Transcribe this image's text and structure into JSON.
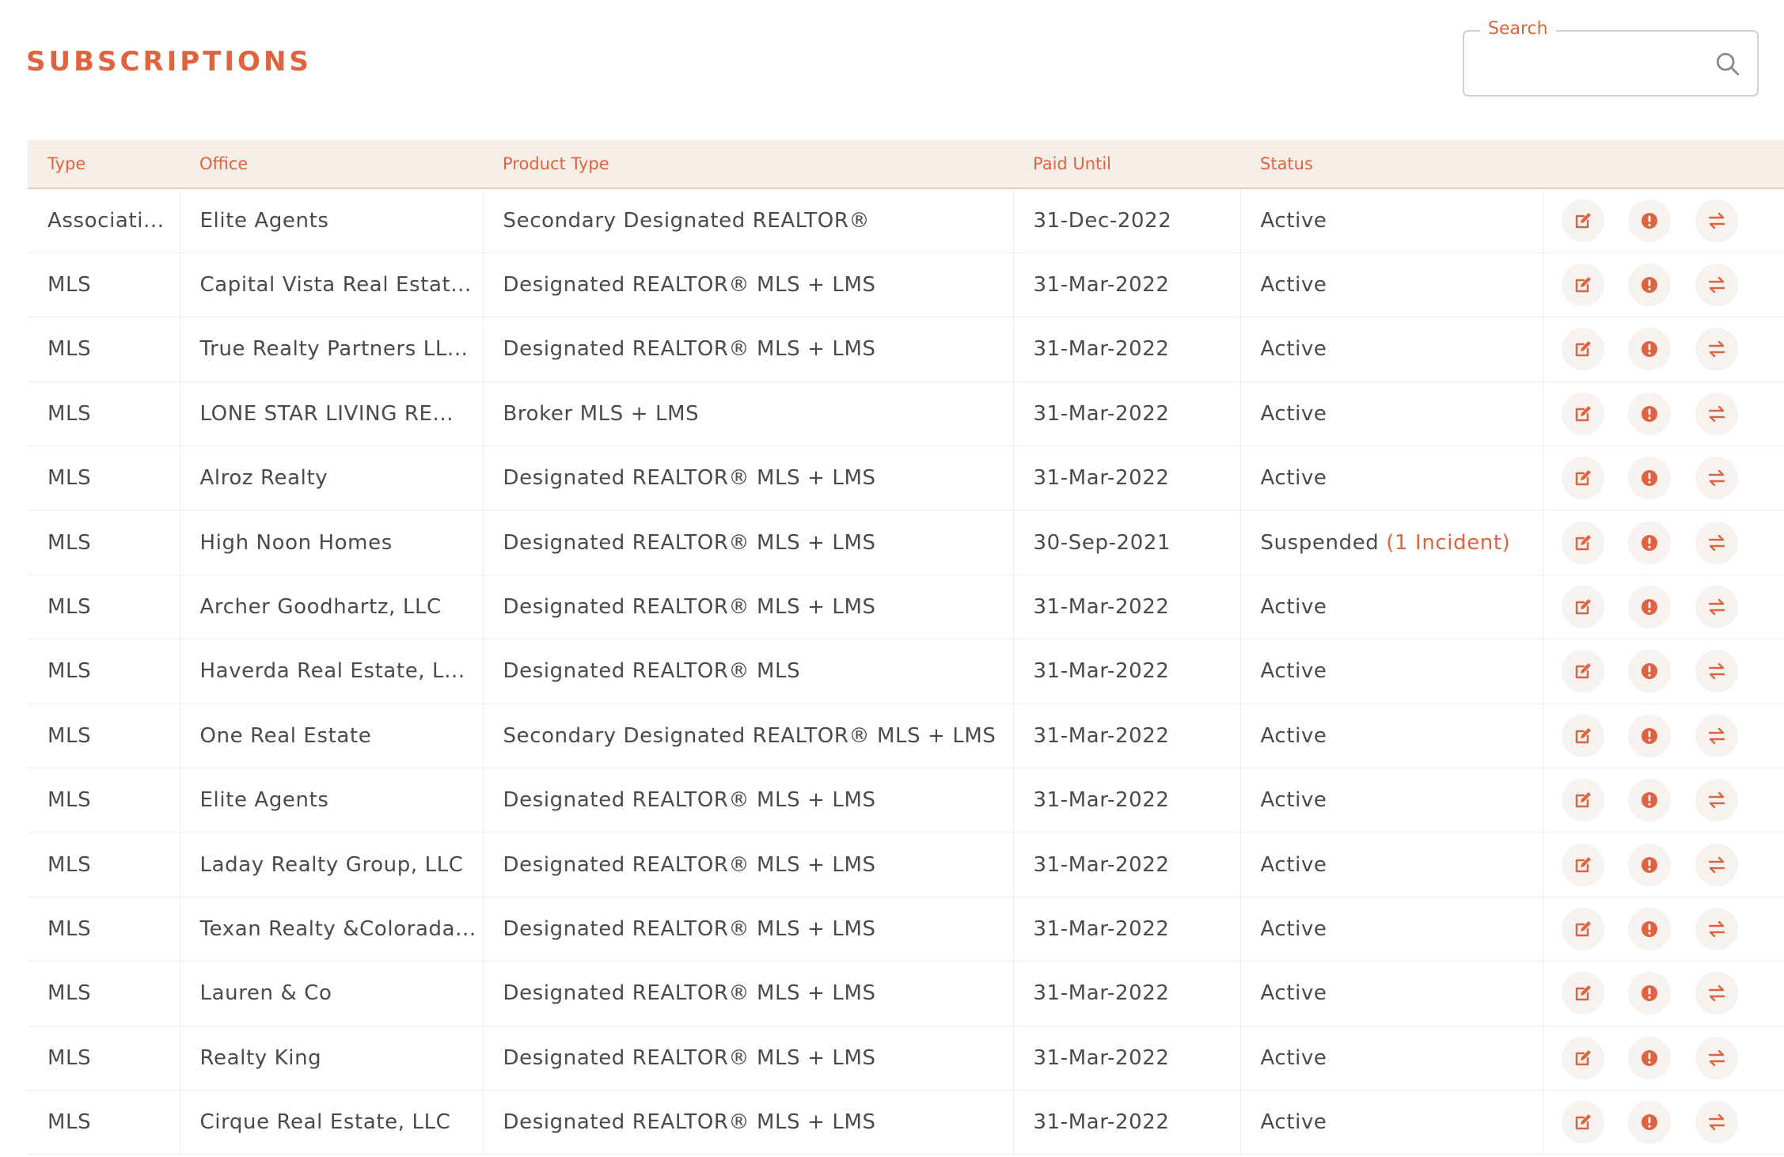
{
  "page": {
    "title": "SUBSCRIPTIONS"
  },
  "search": {
    "label": "Search",
    "value": "",
    "placeholder": ""
  },
  "colors": {
    "accent": "#e0633f",
    "header_bg": "#f7eee8",
    "button_bg": "#f5f2f0"
  },
  "table": {
    "columns": [
      "Type",
      "Office",
      "Product Type",
      "Paid Until",
      "Status",
      ""
    ],
    "actions": [
      "edit-icon",
      "alert-icon",
      "transfer-icon"
    ],
    "rows": [
      {
        "type": "Associati...",
        "office": "Elite Agents",
        "product": "Secondary Designated REALTOR®",
        "paid_until": "31-Dec-2022",
        "status": "Active",
        "incident": ""
      },
      {
        "type": "MLS",
        "office": "Capital Vista Real Estat...",
        "product": "Designated REALTOR® MLS + LMS",
        "paid_until": "31-Mar-2022",
        "status": "Active",
        "incident": ""
      },
      {
        "type": "MLS",
        "office": "True Realty Partners LL...",
        "product": "Designated REALTOR® MLS + LMS",
        "paid_until": "31-Mar-2022",
        "status": "Active",
        "incident": ""
      },
      {
        "type": "MLS",
        "office": "LONE STAR LIVING RE...",
        "product": "Broker MLS + LMS",
        "paid_until": "31-Mar-2022",
        "status": "Active",
        "incident": ""
      },
      {
        "type": "MLS",
        "office": "Alroz Realty",
        "product": "Designated REALTOR® MLS + LMS",
        "paid_until": "31-Mar-2022",
        "status": "Active",
        "incident": ""
      },
      {
        "type": "MLS",
        "office": "High Noon Homes",
        "product": "Designated REALTOR® MLS + LMS",
        "paid_until": "30-Sep-2021",
        "status": "Suspended",
        "incident": "(1 Incident)"
      },
      {
        "type": "MLS",
        "office": "Archer Goodhartz, LLC",
        "product": "Designated REALTOR® MLS + LMS",
        "paid_until": "31-Mar-2022",
        "status": "Active",
        "incident": ""
      },
      {
        "type": "MLS",
        "office": "Haverda Real Estate, L...",
        "product": "Designated REALTOR® MLS",
        "paid_until": "31-Mar-2022",
        "status": "Active",
        "incident": ""
      },
      {
        "type": "MLS",
        "office": "One Real Estate",
        "product": "Secondary Designated REALTOR® MLS + LMS",
        "paid_until": "31-Mar-2022",
        "status": "Active",
        "incident": ""
      },
      {
        "type": "MLS",
        "office": "Elite Agents",
        "product": "Designated REALTOR® MLS + LMS",
        "paid_until": "31-Mar-2022",
        "status": "Active",
        "incident": ""
      },
      {
        "type": "MLS",
        "office": "Laday Realty Group, LLC",
        "product": "Designated REALTOR® MLS + LMS",
        "paid_until": "31-Mar-2022",
        "status": "Active",
        "incident": ""
      },
      {
        "type": "MLS",
        "office": "Texan Realty &Colorada...",
        "product": "Designated REALTOR® MLS + LMS",
        "paid_until": "31-Mar-2022",
        "status": "Active",
        "incident": ""
      },
      {
        "type": "MLS",
        "office": "Lauren & Co",
        "product": "Designated REALTOR® MLS + LMS",
        "paid_until": "31-Mar-2022",
        "status": "Active",
        "incident": ""
      },
      {
        "type": "MLS",
        "office": "Realty King",
        "product": "Designated REALTOR® MLS + LMS",
        "paid_until": "31-Mar-2022",
        "status": "Active",
        "incident": ""
      },
      {
        "type": "MLS",
        "office": "Cirque Real Estate, LLC",
        "product": "Designated REALTOR® MLS + LMS",
        "paid_until": "31-Mar-2022",
        "status": "Active",
        "incident": ""
      }
    ]
  }
}
